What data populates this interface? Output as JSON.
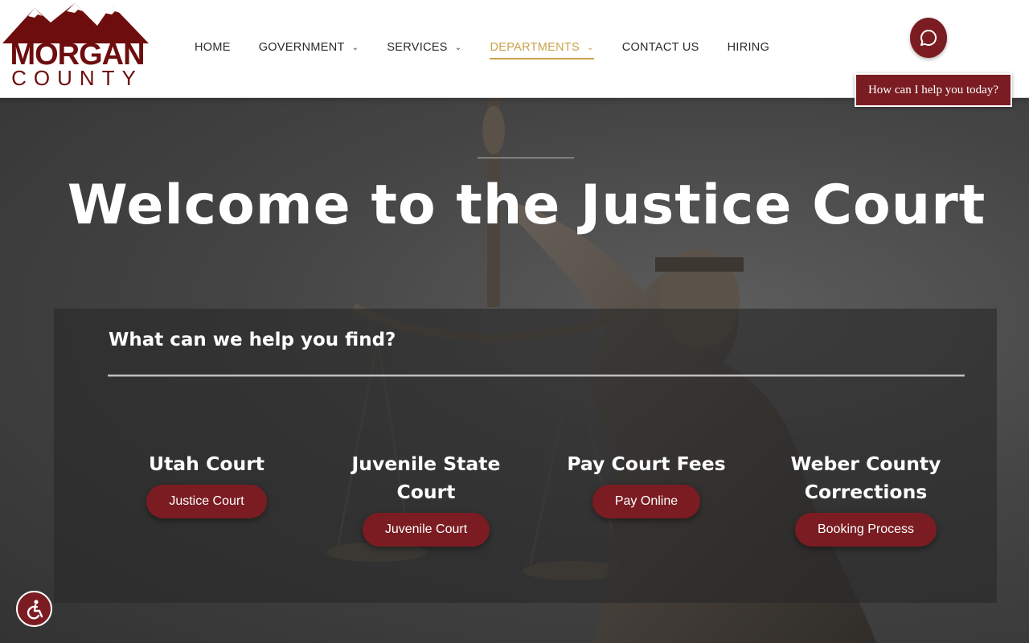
{
  "logo": {
    "line1": "MORGAN",
    "line2": "COUNTY"
  },
  "nav": {
    "items": [
      {
        "label": "HOME",
        "has_dropdown": false,
        "active": false
      },
      {
        "label": "GOVERNMENT",
        "has_dropdown": true,
        "active": false
      },
      {
        "label": "SERVICES",
        "has_dropdown": true,
        "active": false
      },
      {
        "label": "DEPARTMENTS",
        "has_dropdown": true,
        "active": true
      },
      {
        "label": "CONTACT US",
        "has_dropdown": false,
        "active": false
      },
      {
        "label": "HIRING",
        "has_dropdown": false,
        "active": false
      }
    ]
  },
  "chat": {
    "tooltip": "How can I help you today?",
    "icon": "chat-bubble-icon"
  },
  "hero": {
    "title": "Welcome to the Justice Court"
  },
  "panel": {
    "title": "What can we help you find?",
    "cards": [
      {
        "title": "Utah Court",
        "button": "Justice Court"
      },
      {
        "title": "Juvenile State Court",
        "button": "Juvenile Court"
      },
      {
        "title": "Pay Court Fees",
        "button": "Pay Online"
      },
      {
        "title": "Weber County Corrections",
        "button": "Booking Process"
      }
    ]
  },
  "accessibility": {
    "icon": "accessibility-icon"
  },
  "colors": {
    "brand": "#7a1c22",
    "accent": "#c9a24a",
    "logo": "#6e0d0d"
  }
}
